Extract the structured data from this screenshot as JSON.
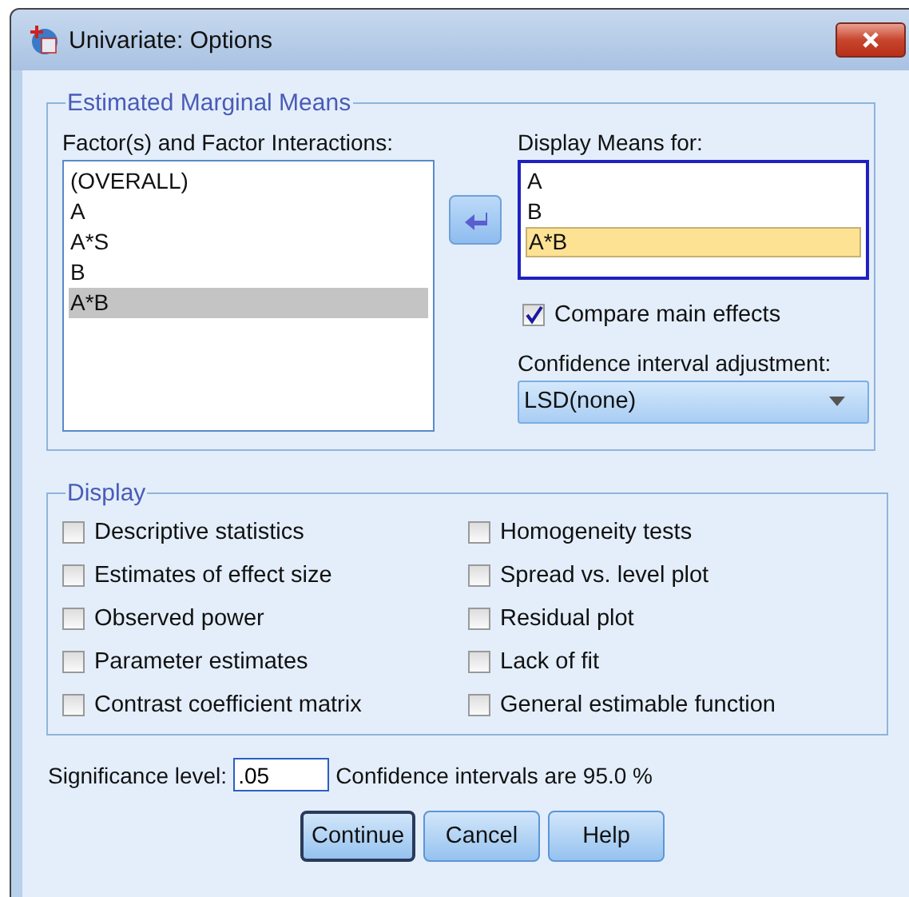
{
  "window": {
    "title": "Univariate: Options"
  },
  "estimated_marginal_means": {
    "title": "Estimated Marginal Means",
    "factors": {
      "label": "Factor(s) and Factor Interactions:",
      "items": [
        {
          "text": "(OVERALL)",
          "selected": false
        },
        {
          "text": "A",
          "selected": false
        },
        {
          "text": "A*S",
          "selected": false
        },
        {
          "text": "B",
          "selected": false
        },
        {
          "text": "A*B",
          "selected": true
        }
      ]
    },
    "display_means": {
      "label": "Display Means for:",
      "items": [
        {
          "text": "A",
          "selected": false
        },
        {
          "text": "B",
          "selected": false
        },
        {
          "text": "A*B",
          "selected": true
        }
      ]
    },
    "compare_main_effects": {
      "label": "Compare main effects",
      "checked": true
    },
    "ci_adjustment": {
      "label": "Confidence interval adjustment:",
      "value": "LSD(none)"
    }
  },
  "display": {
    "title": "Display",
    "options": [
      {
        "label": "Descriptive statistics",
        "checked": false
      },
      {
        "label": "Estimates of effect size",
        "checked": false
      },
      {
        "label": "Observed power",
        "checked": false
      },
      {
        "label": "Parameter estimates",
        "checked": false
      },
      {
        "label": "Contrast coefficient matrix",
        "checked": false
      },
      {
        "label": "Homogeneity tests",
        "checked": false
      },
      {
        "label": "Spread vs. level plot",
        "checked": false
      },
      {
        "label": "Residual plot",
        "checked": false
      },
      {
        "label": "Lack of fit",
        "checked": false
      },
      {
        "label": "General estimable function",
        "checked": false
      }
    ]
  },
  "significance": {
    "label": "Significance level:",
    "value": ".05",
    "note": "Confidence intervals are 95.0 %"
  },
  "buttons": [
    {
      "label": "Continue",
      "default": true
    },
    {
      "label": "Cancel",
      "default": false
    },
    {
      "label": "Help",
      "default": false
    }
  ]
}
